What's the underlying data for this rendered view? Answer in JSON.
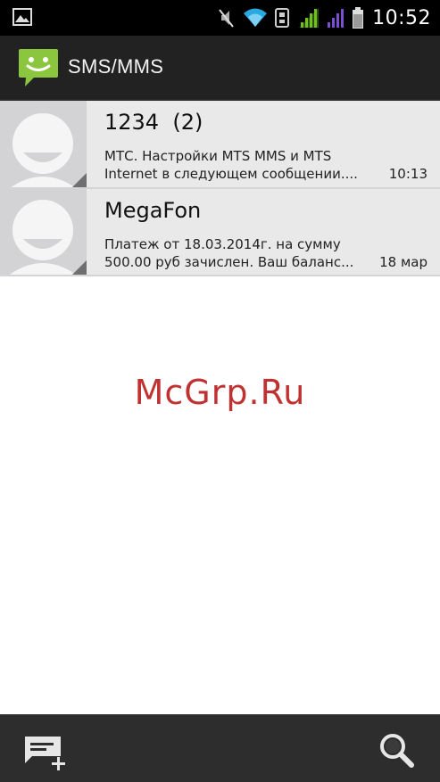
{
  "status_bar": {
    "time": "10:52",
    "icons": [
      "image-notification-icon",
      "muted-icon",
      "wifi-icon",
      "usb-icon",
      "signal-sim1-icon",
      "signal-sim2-icon",
      "battery-icon"
    ]
  },
  "action_bar": {
    "title": "SMS/MMS",
    "icon": "messaging-smiley-icon"
  },
  "threads": [
    {
      "sender": "1234  (2)",
      "preview_line1": "МТС. Настройки MTS MMS и MTS",
      "preview_line2": "Internet в следующем сообщении....",
      "time": "10:13"
    },
    {
      "sender": "MegaFon",
      "preview_line1": "Платеж от 18.03.2014г. на сумму",
      "preview_line2": "500.00 руб зачислен. Ваш баланс...",
      "time": "18 мар"
    }
  ],
  "watermark": "McGrp.Ru",
  "bottom_bar": {
    "compose_icon": "new-message-icon",
    "search_icon": "search-icon"
  },
  "colors": {
    "accent_green": "#8cc63f",
    "signal_green": "#6fbf1f",
    "signal_purple": "#7a4fd0",
    "watermark": "#c03232"
  }
}
